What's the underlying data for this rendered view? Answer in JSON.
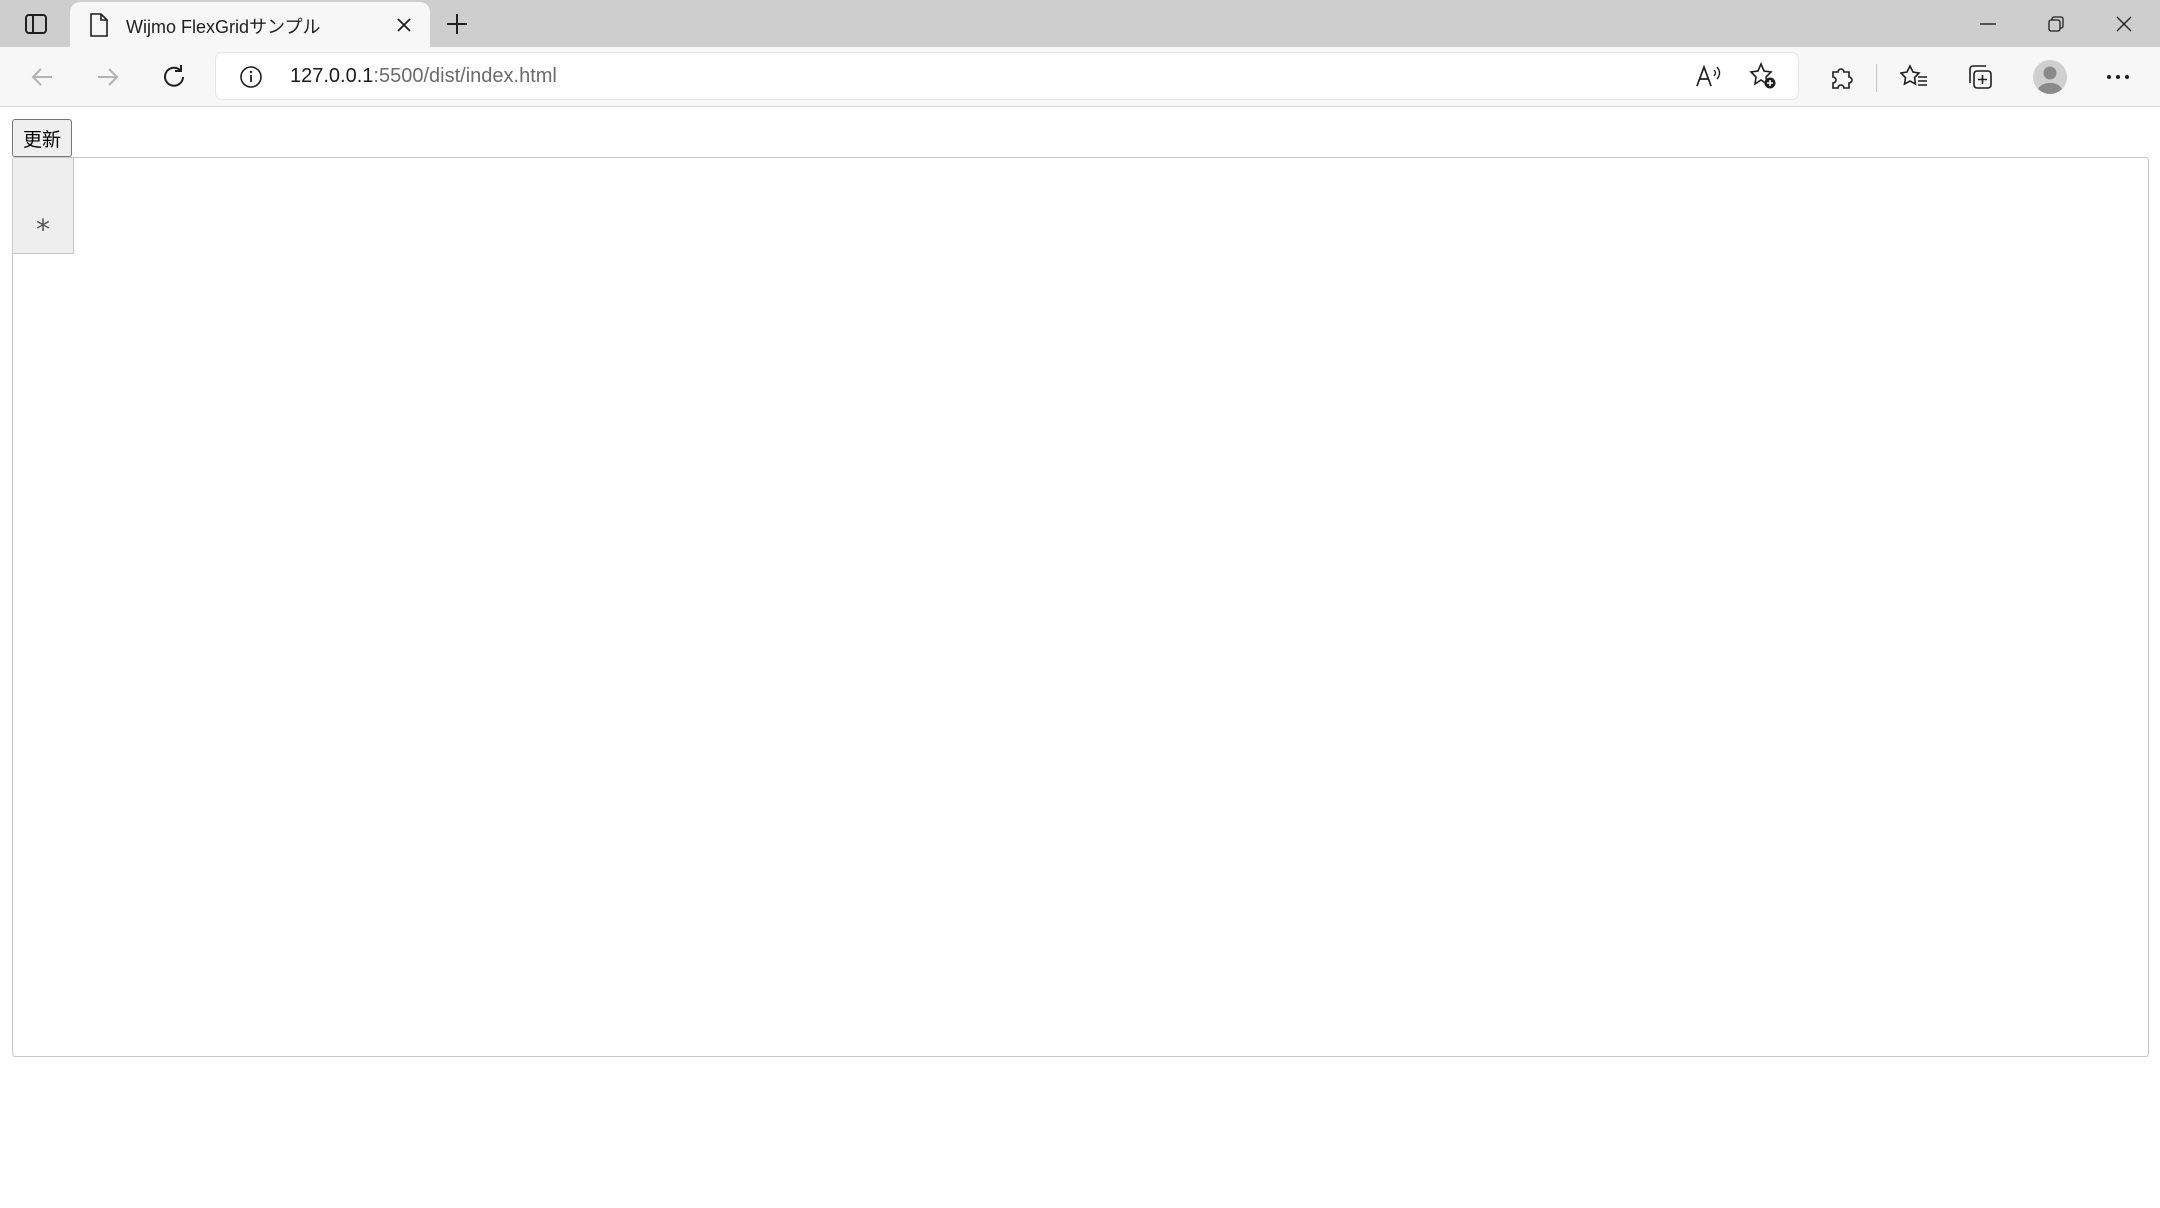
{
  "browser": {
    "tab": {
      "title": "Wijmo FlexGridサンプル"
    },
    "address": {
      "host": "127.0.0.1",
      "rest": ":5500/dist/index.html"
    },
    "icons": {
      "tab_actions": "tab-actions-icon",
      "page": "page-icon",
      "close": "close-icon",
      "new_tab": "plus-icon",
      "back": "back-arrow-icon",
      "forward": "forward-arrow-icon",
      "refresh": "refresh-icon",
      "info": "info-icon",
      "read_aloud": "read-aloud-icon",
      "add_favorite": "add-favorite-icon",
      "extensions": "puzzle-icon",
      "favorites": "favorites-icon",
      "collections": "collections-icon",
      "profile": "profile-icon",
      "more": "more-icon",
      "minimize": "minimize-icon",
      "restore": "restore-icon",
      "window_close": "close-icon"
    }
  },
  "page": {
    "update_button": "更新",
    "grid": {
      "new_row_marker": "*"
    }
  },
  "colors": {
    "tabstrip": "#cecece",
    "toolbar": "#f7f7f7",
    "grid_header": "#eeeeee",
    "grid_border": "#c8c8c8"
  }
}
